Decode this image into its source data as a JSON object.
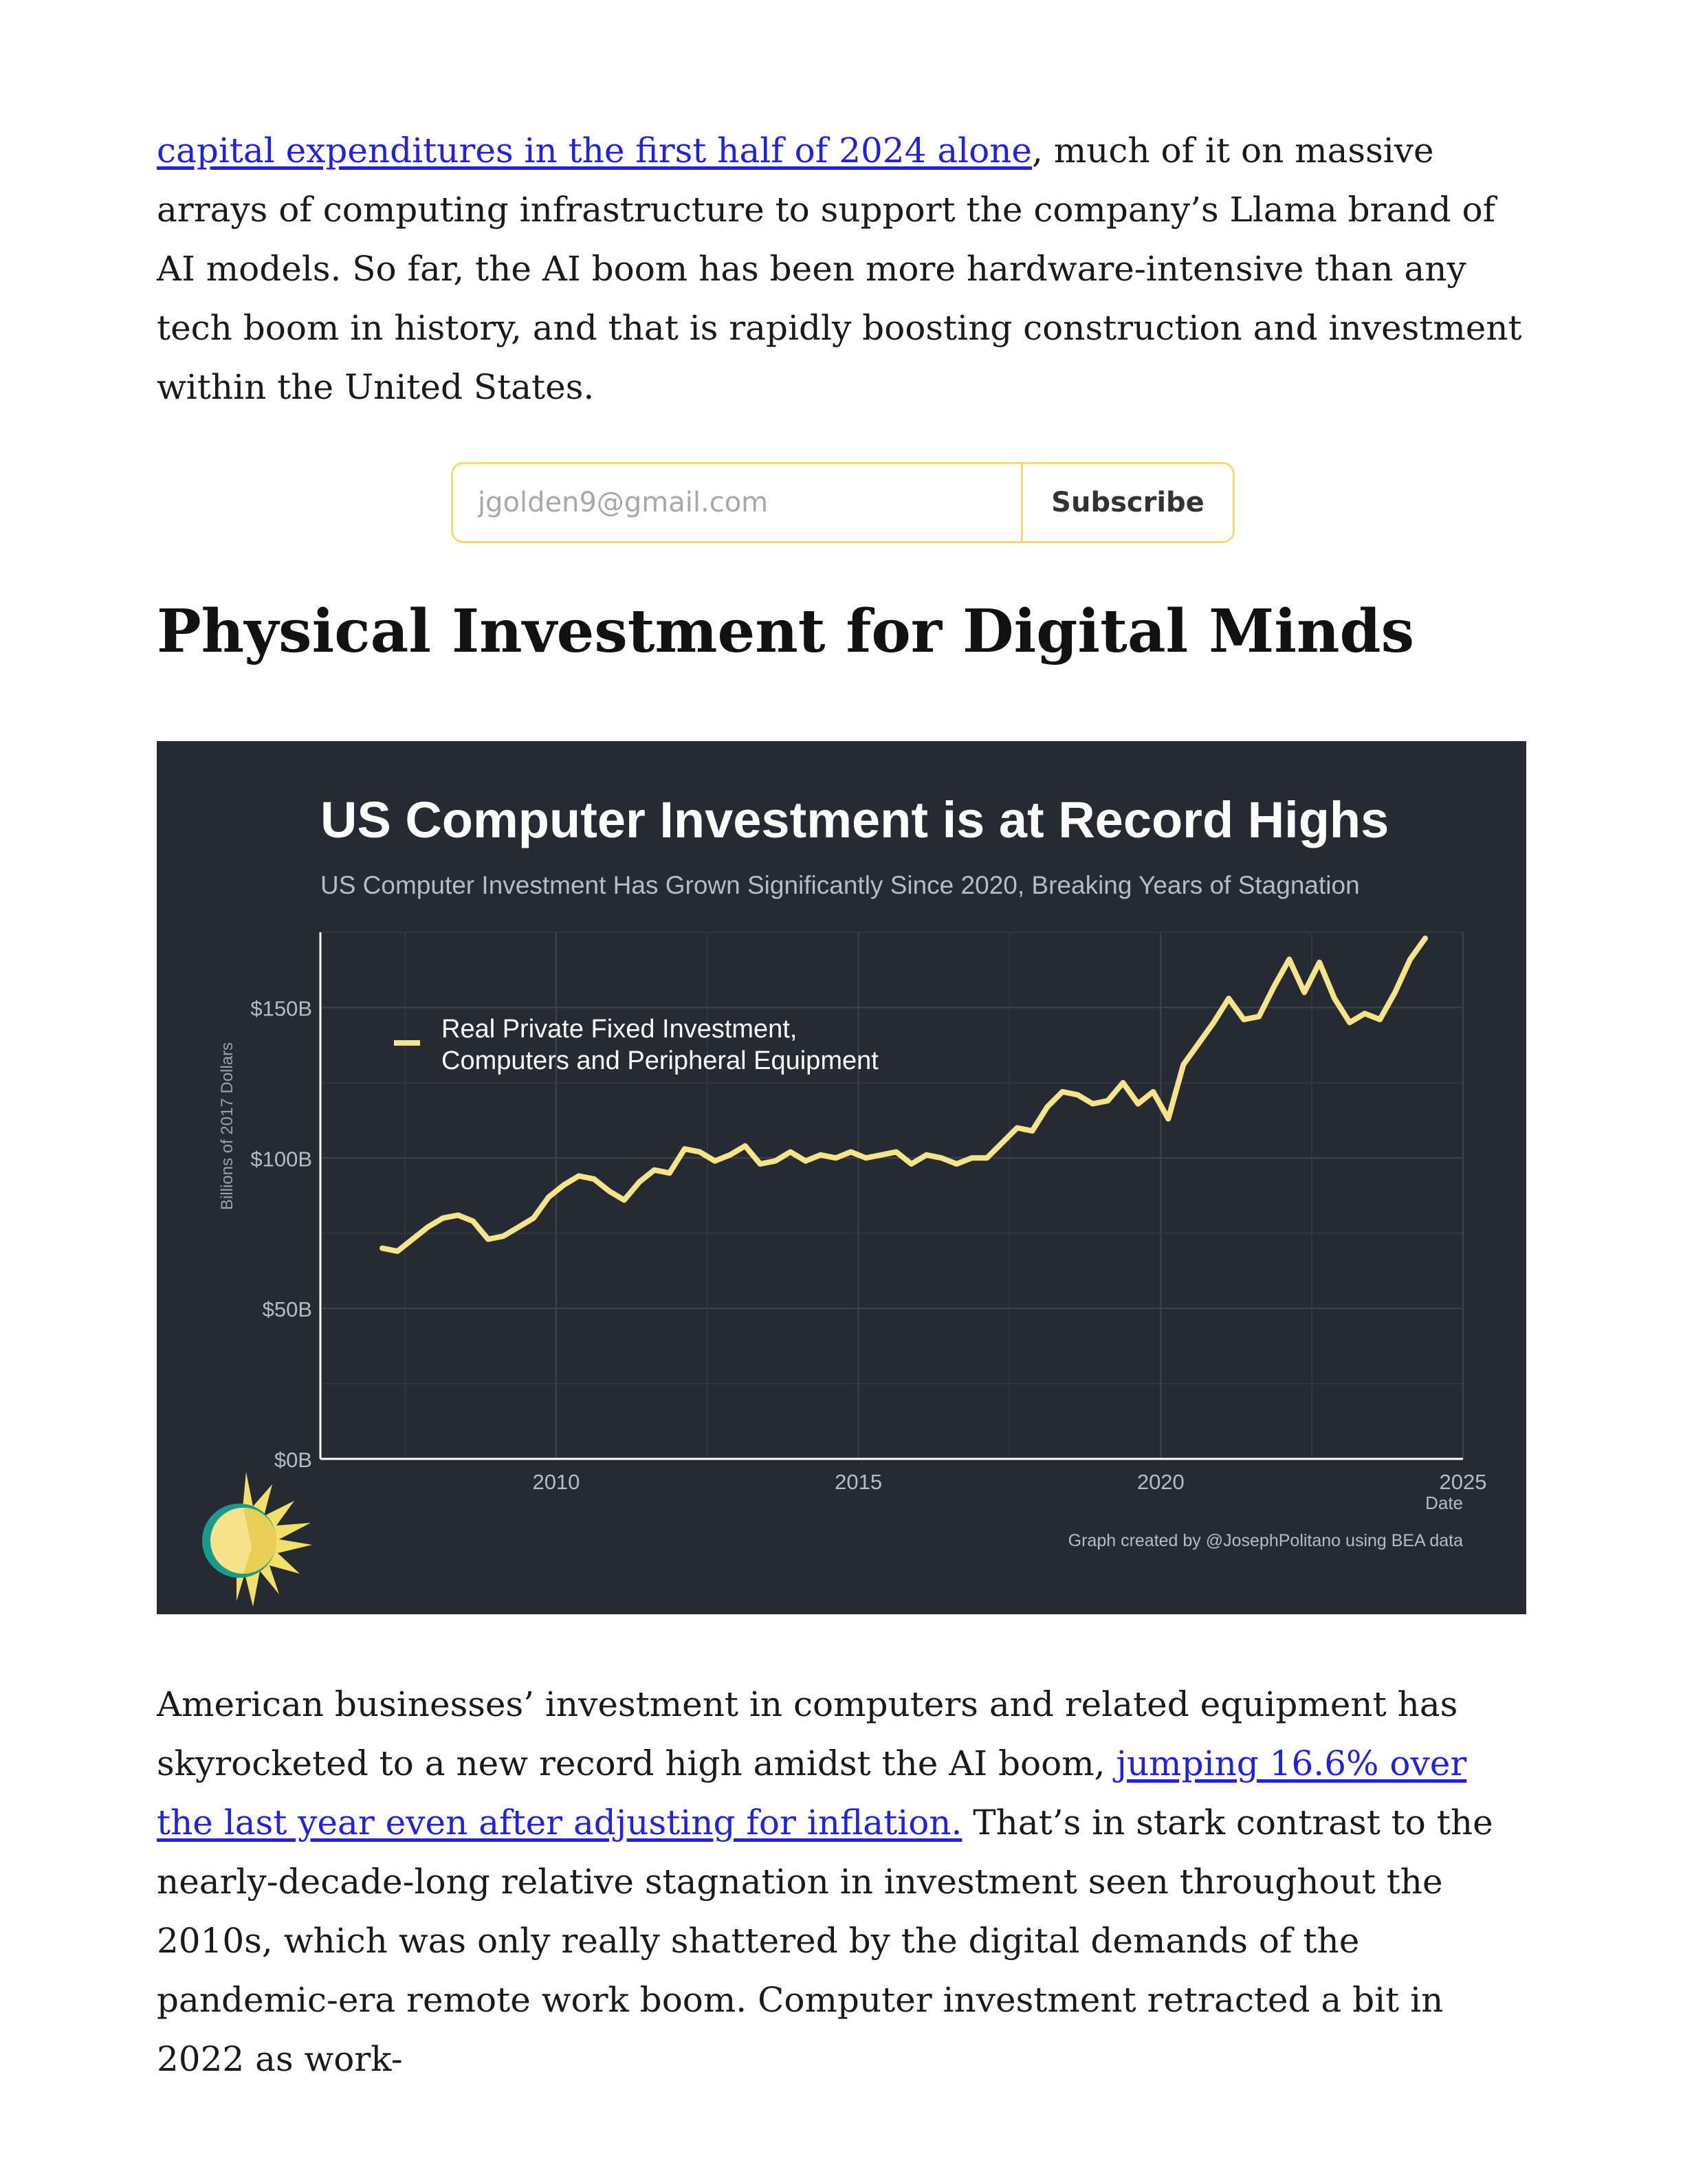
{
  "article": {
    "p1_link": "capital expenditures in the first half of 2024 alone",
    "p1_rest": ", much of it on massive arrays of computing infrastructure to support the company’s Llama brand of AI models. So far, the AI boom has been more hardware-intensive than any tech boom in history, and that is rapidly boosting construction and investment within the United States.",
    "heading": "Physical Investment for Digital Minds",
    "p2_start": "American businesses’ investment in computers and related equipment has skyrocketed to a new record high amidst the AI boom, ",
    "p2_link": "jumping 16.6% over the last year even after adjusting for inflation.",
    "p2_rest": " That’s in stark contrast to the nearly-decade-long relative stagnation in investment seen throughout the 2010s, which was only really shattered by the digital demands of the pandemic-era remote work boom. Computer investment retracted a bit in 2022 as work-"
  },
  "subscribe": {
    "email_value": "jgolden9@gmail.com",
    "button_label": "Subscribe"
  },
  "colors": {
    "chart_background": "#262b33",
    "line": "#f6e38a",
    "link": "#2222dd",
    "subscribe_border": "#f2dc73"
  },
  "icons": {
    "logo": "sun-logo-icon"
  },
  "chart_data": {
    "type": "line",
    "title": "US Computer Investment is at Record Highs",
    "subtitle": "US Computer Investment Has Grown Significantly Since 2020, Breaking Years of Stagnation",
    "ylabel": "Billions of 2017 Dollars",
    "xlabel": "Date",
    "credit": "Graph created by @JosephPolitano using BEA data",
    "legend": "top-left",
    "legend_lines": [
      "Real Private Fixed Investment,",
      "Computers and Peripheral Equipment"
    ],
    "series": [
      {
        "name": "Real Private Fixed Investment, Computers and Peripheral Equipment",
        "x": [
          2007.125,
          2007.375,
          2007.625,
          2007.875,
          2008.125,
          2008.375,
          2008.625,
          2008.875,
          2009.125,
          2009.375,
          2009.625,
          2009.875,
          2010.125,
          2010.375,
          2010.625,
          2010.875,
          2011.125,
          2011.375,
          2011.625,
          2011.875,
          2012.125,
          2012.375,
          2012.625,
          2012.875,
          2013.125,
          2013.375,
          2013.625,
          2013.875,
          2014.125,
          2014.375,
          2014.625,
          2014.875,
          2015.125,
          2015.375,
          2015.625,
          2015.875,
          2016.125,
          2016.375,
          2016.625,
          2016.875,
          2017.125,
          2017.375,
          2017.625,
          2017.875,
          2018.125,
          2018.375,
          2018.625,
          2018.875,
          2019.125,
          2019.375,
          2019.625,
          2019.875,
          2020.125,
          2020.375,
          2020.625,
          2020.875,
          2021.125,
          2021.375,
          2021.625,
          2021.875,
          2022.125,
          2022.375,
          2022.625,
          2022.875,
          2023.125,
          2023.375,
          2023.625,
          2023.875,
          2024.125,
          2024.375
        ],
        "values": [
          70,
          69,
          73,
          77,
          80,
          81,
          79,
          73,
          74,
          77,
          80,
          87,
          91,
          94,
          93,
          89,
          86,
          92,
          96,
          95,
          103,
          102,
          99,
          101,
          104,
          98,
          99,
          102,
          99,
          101,
          100,
          102,
          100,
          101,
          102,
          98,
          101,
          100,
          98,
          100,
          100,
          105,
          110,
          109,
          117,
          122,
          121,
          118,
          119,
          125,
          118,
          122,
          113,
          131,
          138,
          145,
          153,
          146,
          147,
          157,
          166,
          155,
          165,
          153,
          145,
          148,
          146,
          155,
          166,
          173
        ]
      }
    ],
    "xticks": [
      "2010",
      "2015",
      "2020",
      "2025"
    ],
    "xtick_values": [
      2010,
      2015,
      2020,
      2025
    ],
    "yticks": [
      "$0B",
      "$50B",
      "$100B",
      "$150B"
    ],
    "ytick_values": [
      0,
      50,
      100,
      150
    ],
    "xlim": [
      2006.1,
      2025.0
    ],
    "ylim": [
      0,
      175
    ],
    "grid": true
  }
}
